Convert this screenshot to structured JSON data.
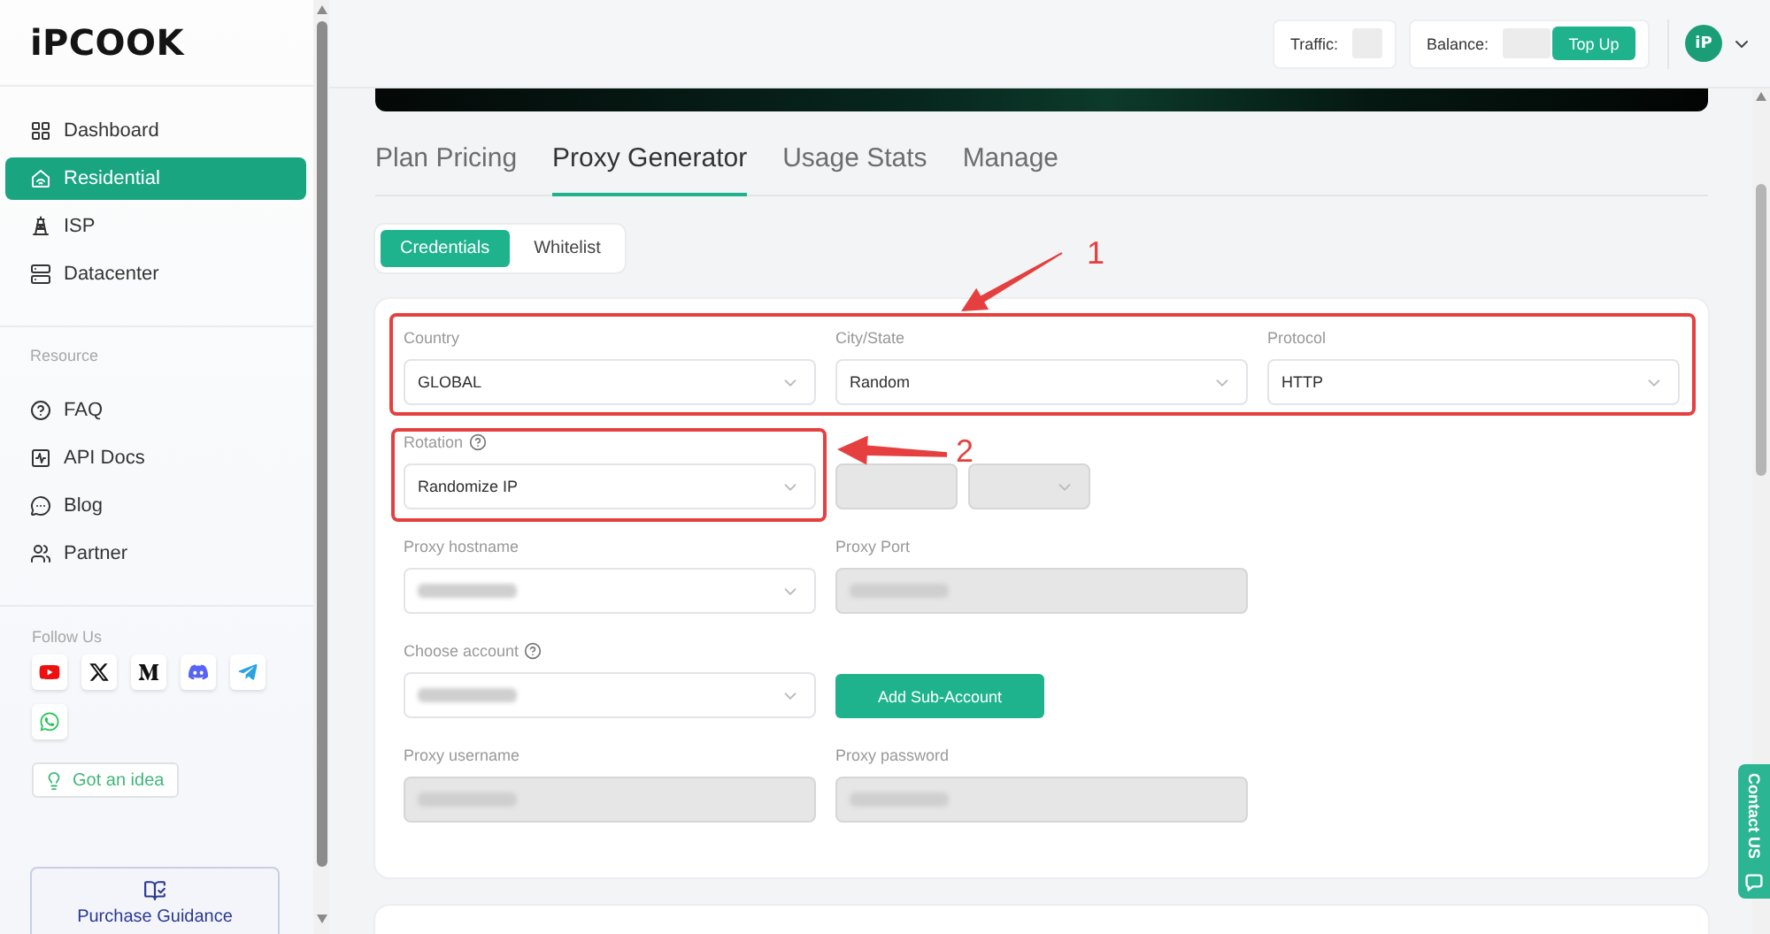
{
  "sidebar": {
    "logo": "iPCOOK",
    "nav": [
      {
        "label": "Dashboard",
        "selected": false
      },
      {
        "label": "Residential",
        "selected": true
      },
      {
        "label": "ISP",
        "selected": false
      },
      {
        "label": "Datacenter",
        "selected": false
      }
    ],
    "resource_heading": "Resource",
    "resources": [
      "FAQ",
      "API Docs",
      "Blog",
      "Partner"
    ],
    "follow_heading": "Follow Us",
    "idea_button": "Got an idea",
    "guidance_button": "Purchase Guidance"
  },
  "header": {
    "traffic_label": "Traffic:",
    "balance_label": "Balance:",
    "top_up_button": "Top Up",
    "avatar": "iP"
  },
  "tabs": [
    {
      "label": "Plan Pricing",
      "selected": false
    },
    {
      "label": "Proxy Generator",
      "selected": true
    },
    {
      "label": "Usage Stats",
      "selected": false
    },
    {
      "label": "Manage",
      "selected": false
    }
  ],
  "credential_modes": [
    {
      "label": "Credentials",
      "selected": true
    },
    {
      "label": "Whitelist",
      "selected": false
    }
  ],
  "form": {
    "rows": [
      {
        "highlighted": true,
        "fields": [
          {
            "kind": "select",
            "label": "Country",
            "value": "GLOBAL",
            "help": false,
            "highlighted": false,
            "disabled": false,
            "redacted": false
          },
          {
            "kind": "select",
            "label": "City/State",
            "value": "Random",
            "help": false,
            "highlighted": false,
            "disabled": false,
            "redacted": false
          },
          {
            "kind": "select",
            "label": "Protocol",
            "value": "HTTP",
            "help": false,
            "highlighted": false,
            "disabled": false,
            "redacted": false
          }
        ]
      },
      {
        "highlighted": false,
        "fields": [
          {
            "kind": "select",
            "label": "Rotation",
            "value": "Randomize IP",
            "help": true,
            "highlighted": true,
            "disabled": false,
            "redacted": false
          },
          {
            "kind": "mini-input",
            "help": false,
            "highlighted": false,
            "disabled": true,
            "redacted": false
          },
          {
            "kind": "mini-select",
            "help": false,
            "highlighted": false,
            "disabled": true,
            "redacted": false
          }
        ]
      },
      {
        "highlighted": false,
        "fields": [
          {
            "kind": "select",
            "label": "Proxy hostname",
            "help": false,
            "highlighted": false,
            "disabled": false,
            "redacted": true
          },
          {
            "kind": "input",
            "label": "Proxy Port",
            "help": false,
            "highlighted": false,
            "disabled": true,
            "redacted": true
          }
        ]
      },
      {
        "highlighted": false,
        "fields": [
          {
            "kind": "select",
            "label": "Choose account",
            "help": true,
            "highlighted": false,
            "disabled": false,
            "redacted": true
          },
          {
            "kind": "button",
            "text": "Add Sub-Account",
            "help": false,
            "highlighted": false,
            "disabled": false,
            "redacted": false
          }
        ]
      },
      {
        "highlighted": false,
        "fields": [
          {
            "kind": "input",
            "label": "Proxy username",
            "help": false,
            "highlighted": false,
            "disabled": true,
            "redacted": true
          },
          {
            "kind": "input",
            "label": "Proxy password",
            "help": false,
            "highlighted": false,
            "disabled": true,
            "redacted": true
          }
        ]
      }
    ]
  },
  "callouts": [
    {
      "number": "1"
    },
    {
      "number": "2"
    }
  ],
  "contact_tab": "Contact US"
}
